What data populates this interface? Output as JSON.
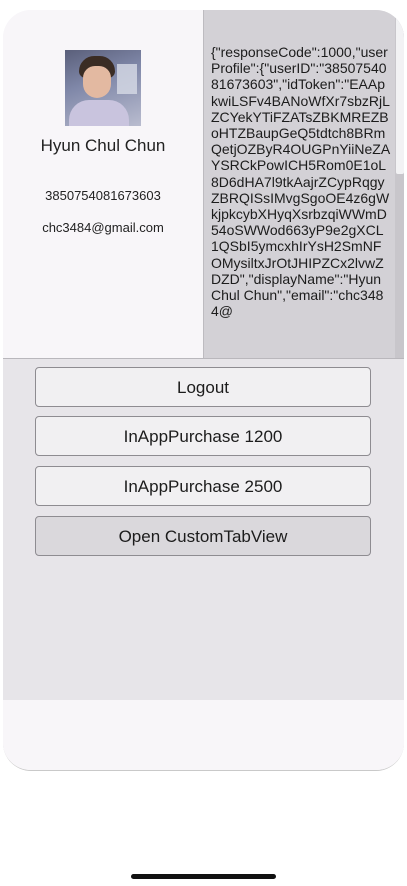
{
  "profile": {
    "display_name": "Hyun Chul Chun",
    "user_id": "3850754081673603",
    "email": "chc3484@gmail.com"
  },
  "response_text": "{\"responseCode\":1000,\"userProfile\":{\"userID\":\"3850754081673603\",\"idToken\":\"EAApkwiLSFv4BANoWfXr7sbzRjLZCYekYTiFZATsZBKMREZBoHTZBaupGeQ5tdtch8BRmQetjOZByR4OUGPnYiiNeZAYSRCkPowICH5Rom0E1oL8D6dHA7l9tkAajrZCypRqgyZBRQISsIMvgSgoOE4z6gWkjpkcybXHyqXsrbzqiWWmD54oSWWod663yP9e2gXCL1QSbI5ymcxhIrYsH2SmNFOMysiltxJrOtJHIPZCx2lvwZDZD\",\"displayName\":\"Hyun Chul Chun\",\"email\":\"chc3484@",
  "buttons": {
    "logout": "Logout",
    "iap_1200": "InAppPurchase 1200",
    "iap_2500": "InAppPurchase 2500",
    "custom_tab": "Open CustomTabView"
  }
}
